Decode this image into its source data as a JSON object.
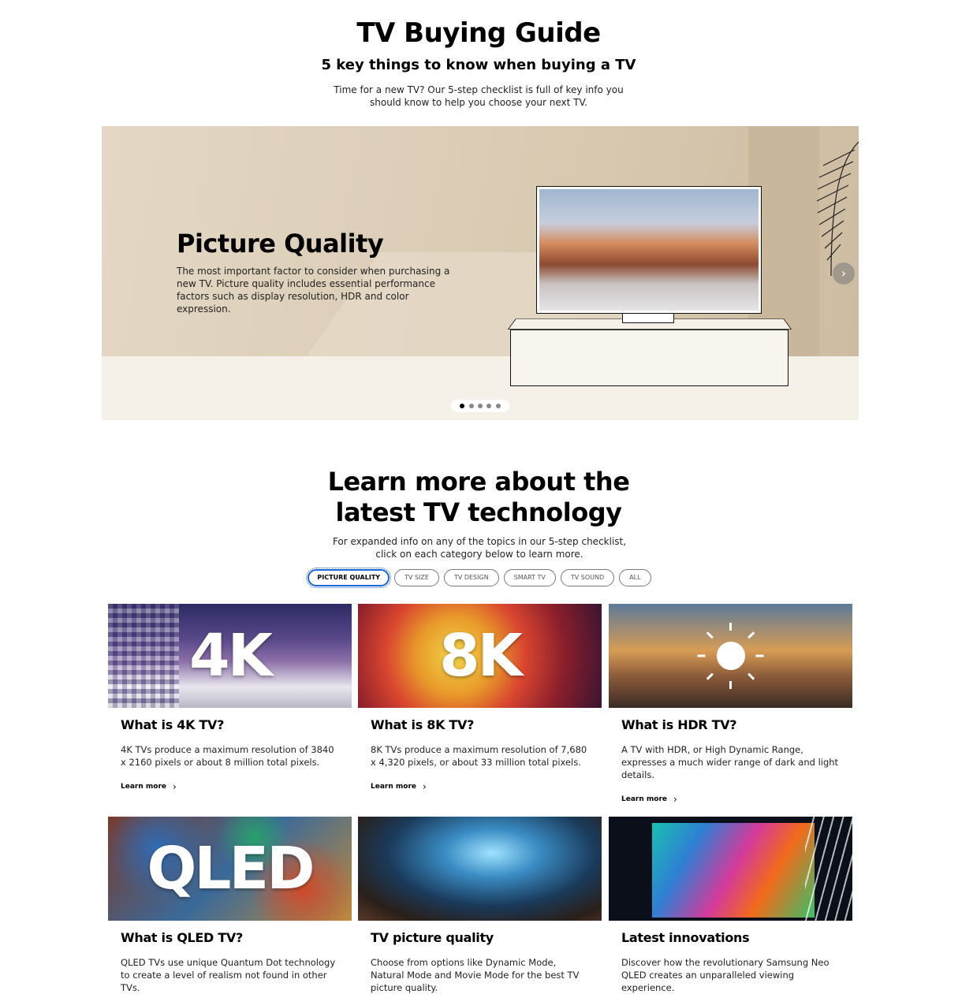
{
  "header": {
    "title": "TV Buying Guide",
    "subtitle": "5 key things to know when buying a TV",
    "description": "Time for a new TV? Our 5-step checklist is full of key info you should know to help you choose your next TV."
  },
  "banner": {
    "title": "Picture Quality",
    "description": "The most important factor to consider when purchasing a new TV. Picture quality includes essential performance factors such as display resolution, HDR and color expression.",
    "next_arrow": "›",
    "dots_count": 5,
    "active_dot": 1
  },
  "learn": {
    "title_line1": "Learn more about the",
    "title_line2": "latest TV technology",
    "description": "For expanded info on any of the topics in our 5-step checklist, click on each category below to learn more.",
    "chips": [
      "PICTURE QUALITY",
      "TV SIZE",
      "TV DESIGN",
      "SMART TV",
      "TV SOUND",
      "ALL"
    ],
    "active_chip": "PICTURE QUALITY"
  },
  "cards": [
    {
      "title": "What is 4K TV?",
      "description": "4K TVs produce a maximum resolution of 3840 x 2160 pixels or about 8 million total pixels.",
      "link": "Learn more",
      "image_text": "4K"
    },
    {
      "title": "What is 8K TV?",
      "description": "8K TVs produce a maximum resolution of 7,680 x 4,320 pixels, or about 33 million total pixels.",
      "link": "Learn more",
      "image_text": "8K"
    },
    {
      "title": "What is HDR TV?",
      "description": "A TV with HDR, or High Dynamic Range, expresses a much wider range of dark and light details.",
      "link": "Learn more",
      "image_icon": "sun-icon"
    },
    {
      "title": "What is QLED TV?",
      "description": "QLED TVs use unique Quantum Dot technology to create a level of realism not found in other TVs.",
      "image_text": "QLED"
    },
    {
      "title": "TV picture quality",
      "description": "Choose from options like Dynamic Mode, Natural Mode and Movie Mode for the best TV picture quality."
    },
    {
      "title": "Latest innovations",
      "description": "Discover how the revolutionary Samsung Neo QLED creates an unparalleled viewing experience."
    }
  ],
  "colors": {
    "chip_active_border": "#1a66d9",
    "banner_bg": "#dcd0bd"
  }
}
